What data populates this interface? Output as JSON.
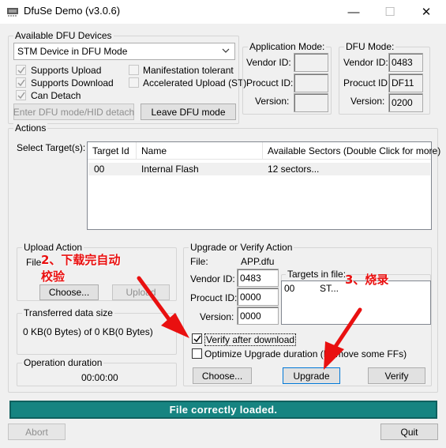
{
  "window": {
    "title": "DfuSe Demo (v3.0.6)",
    "minimize_glyph": "—",
    "maximize_glyph": "☐",
    "close_glyph": "✕"
  },
  "dfu_devices": {
    "group_title": "Available DFU Devices",
    "device_select": "STM Device in DFU Mode",
    "checks": {
      "supports_upload": "Supports Upload",
      "supports_download": "Supports Download",
      "can_detach": "Can Detach",
      "manifestation_tolerant": "Manifestation tolerant",
      "accelerated_upload": "Accelerated Upload (ST)"
    },
    "enter_dfu_button": "Enter DFU mode/HID detach",
    "leave_dfu_button": "Leave DFU mode"
  },
  "application_mode": {
    "group_title": "Application Mode:",
    "vendor_label": "Vendor ID:",
    "product_label": "Procuct ID:",
    "version_label": "Version:",
    "vendor_value": "",
    "product_value": "",
    "version_value": ""
  },
  "dfu_mode": {
    "group_title": "DFU Mode:",
    "vendor_label": "Vendor ID:",
    "product_label": "Procuct ID:",
    "version_label": "Version:",
    "vendor_value": "0483",
    "product_value": "DF11",
    "version_value": "0200"
  },
  "actions": {
    "group_title": "Actions",
    "select_target_label": "Select Target(s):",
    "columns": [
      "Target Id",
      "Name",
      "Available Sectors (Double Click for more)"
    ],
    "rows": [
      {
        "target_id": "00",
        "name": "Internal Flash",
        "sectors": "12 sectors..."
      }
    ]
  },
  "upload_action": {
    "group_title": "Upload Action",
    "file_label": "File",
    "choose_button": "Choose...",
    "upload_button": "Upload"
  },
  "transferred": {
    "group_title": "Transferred data size",
    "value": "0 KB(0 Bytes) of 0 KB(0 Bytes)"
  },
  "operation_duration": {
    "group_title": "Operation duration",
    "value": "00:00:00"
  },
  "upgrade_action": {
    "group_title": "Upgrade or Verify Action",
    "file_label": "File:",
    "file_value": "APP.dfu",
    "vendor_label": "Vendor ID:",
    "vendor_value": "0483",
    "product_label": "Procuct ID:",
    "product_value": "0000",
    "version_label": "Version:",
    "version_value": "0000",
    "targets_title": "Targets in file:",
    "targets_row": {
      "id": "00",
      "name": "ST..."
    },
    "verify_after_download": "Verify after download",
    "optimize_duration": "Optimize Upgrade duration (Remove some FFs)",
    "choose_button": "Choose...",
    "upgrade_button": "Upgrade",
    "verify_button": "Verify"
  },
  "status_text": "File correctly loaded.",
  "abort_button": "Abort",
  "quit_button": "Quit",
  "annotations": {
    "step2_line1": "2、下载完自动",
    "step2_line2": "校验",
    "step3": "3、烧录",
    "color": "#e91010"
  }
}
